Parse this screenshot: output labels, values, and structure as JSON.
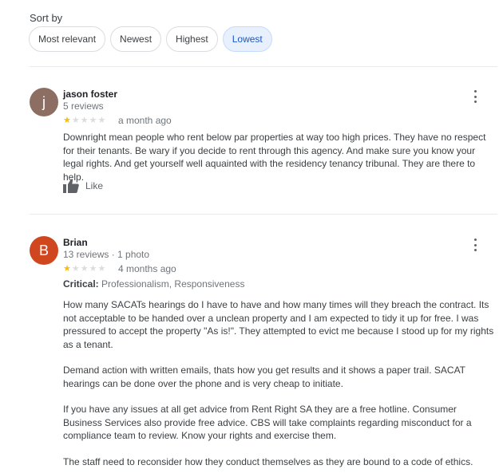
{
  "sort": {
    "label": "Sort by",
    "options": [
      "Most relevant",
      "Newest",
      "Highest",
      "Lowest"
    ],
    "selected": "Lowest"
  },
  "reviews": [
    {
      "avatar_letter": "j",
      "avatar_color": "#8d6e63",
      "name": "jason foster",
      "meta": "5 reviews",
      "rating": 1,
      "max_rating": 5,
      "date": "a month ago",
      "text": "Downright mean people who rent below par properties at way too high prices. They have no respect for their tenants. Be wary if you decide to rent through this agency. And make sure you know your legal rights. And get yourself well aquainted with the residency tenancy tribunal.  They are there to help.",
      "like_label": "Like",
      "like_icon": "thumbs-up-icon"
    },
    {
      "avatar_letter": "B",
      "avatar_color": "#d0471f",
      "name": "Brian",
      "meta": "13 reviews · 1 photo",
      "rating": 1,
      "max_rating": 5,
      "date": "4 months ago",
      "critical_label": "Critical:",
      "critical_value": "Professionalism, Responsiveness",
      "paragraphs": [
        "How many SACATs hearings do I have to have and how many times will they breach the contract. Its not acceptable to be handed over a unclean property and I am expected to tidy it up for free. I was pressured to accept the property \"As is!\". They attempted to evict me because I stood up for my rights as a tenant.",
        "Demand action with written emails, thats how you get results and it shows a paper trail. SACAT hearings can be done over the phone and is very cheap to initiate.",
        "If you have any issues at all get advice from Rent Right SA they are a free hotline. Consumer Business Services also provide free advice. CBS will take complaints regarding misconduct for a compliance team to review. Know your rights and exercise them.",
        "The staff need to reconsider how they conduct themselves as they are bound to a code of ethics."
      ]
    }
  ]
}
